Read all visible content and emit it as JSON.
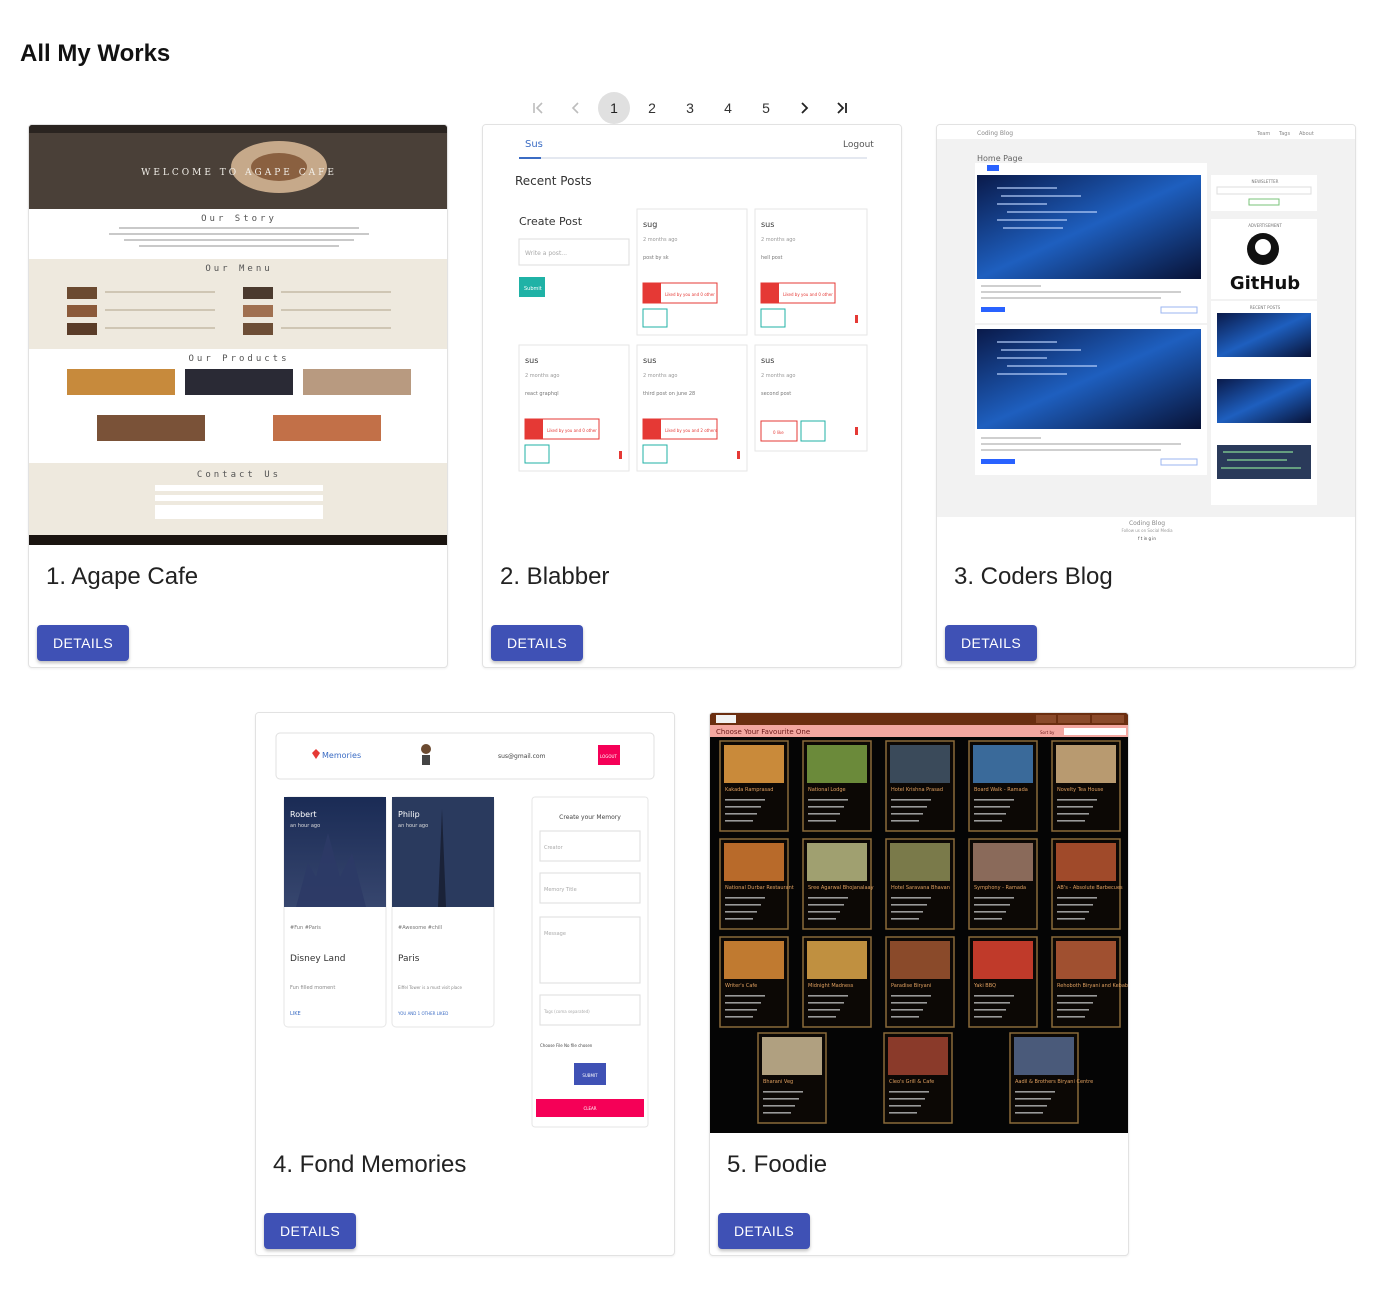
{
  "page": {
    "title": "All My Works"
  },
  "pagination": {
    "first_icon": "first-page-icon",
    "prev_icon": "chevron-left-icon",
    "next_icon": "chevron-right-icon",
    "last_icon": "last-page-icon",
    "pages": [
      "1",
      "2",
      "3",
      "4",
      "5"
    ],
    "current": "1"
  },
  "accent": "#3f51b5",
  "works": [
    {
      "title": "1. Agape Cafe",
      "button": "DETAILS",
      "preview": {
        "hero": "WELCOME TO AGAPE CAFE",
        "sections": [
          "Our Story",
          "Our Menu",
          "Our Products",
          "Contact Us"
        ]
      }
    },
    {
      "title": "2. Blabber",
      "button": "DETAILS",
      "preview": {
        "tab": "Sus",
        "logout": "Logout",
        "heading": "Recent Posts",
        "create": "Create Post",
        "placeholder": "Write a post...",
        "submit": "Submit",
        "posts": [
          {
            "user": "sug",
            "time": "2 months ago",
            "text": "post by sk",
            "like": "Liked by you and 0 other"
          },
          {
            "user": "sus",
            "time": "2 months ago",
            "text": "hell post",
            "like": "Liked by you and 0 other"
          },
          {
            "user": "sus",
            "time": "2 months ago",
            "text": "react graphql",
            "like": "Liked by you and 0 other"
          },
          {
            "user": "sus",
            "time": "2 months ago",
            "text": "third post on june 28",
            "like": "Liked by you and 2 others"
          },
          {
            "user": "sus",
            "time": "2 months ago",
            "text": "second post",
            "like": "0 like"
          }
        ]
      }
    },
    {
      "title": "3. Coders Blog",
      "button": "DETAILS",
      "preview": {
        "brand": "Coding Blog",
        "nav": [
          "Team",
          "Tags",
          "About"
        ],
        "heading": "Home Page",
        "github": "GitHub",
        "newsletter": "NEWSLETTER",
        "ad": "ADVERTISEMENT",
        "recent": "RECENT POSTS",
        "footer": "Coding Blog",
        "footer_sub": "Follow us on Social Media",
        "social": "f  t  in  g  in"
      }
    },
    {
      "title": "4. Fond Memories",
      "button": "DETAILS",
      "preview": {
        "brand": "Memories",
        "email": "sus@gmail.com",
        "logout": "LOGOUT",
        "cards": [
          {
            "author": "Robert",
            "time": "an hour ago",
            "tags": "#Fun #Paris",
            "place": "Disney Land",
            "msg": "Fun filled moment",
            "action": "LIKE"
          },
          {
            "author": "Philip",
            "time": "an hour ago",
            "tags": "#Awesome #chill",
            "place": "Paris",
            "msg": "Eiffel Tower is a must visit place",
            "action": "YOU AND 1 OTHER LIKED"
          }
        ],
        "form_title": "Create your Memory",
        "fields": [
          "Creator",
          "Memory Title",
          "Message",
          "Tags (coma separated)"
        ],
        "file": "Choose File  No file chosen",
        "submit": "SUBMIT",
        "clear": "CLEAR"
      }
    },
    {
      "title": "5. Foodie",
      "button": "DETAILS",
      "preview": {
        "heading": "Choose Your Favourite One",
        "sort": "Sort by",
        "restaurants": [
          "Kakada Ramprasad",
          "National Lodge",
          "Hotel Krishna Prasad",
          "Board Walk - Ramada",
          "Novelty Tea House",
          "National Durbar Restaurant",
          "Sree Agarwal Bhojanalaay",
          "Hotel Saravana Bhavan",
          "Symphony - Ramada",
          "AB's - Absolute Barbecues",
          "Writer's Cafe",
          "Midnight Madness",
          "Paradise Biryani",
          "Yaki BBQ",
          "Rehoboth Biryani and Kebabs",
          "Bharani Veg",
          "Cleo's Grill & Cafe",
          "Aadil & Brothers Biryani Centre"
        ]
      }
    }
  ]
}
